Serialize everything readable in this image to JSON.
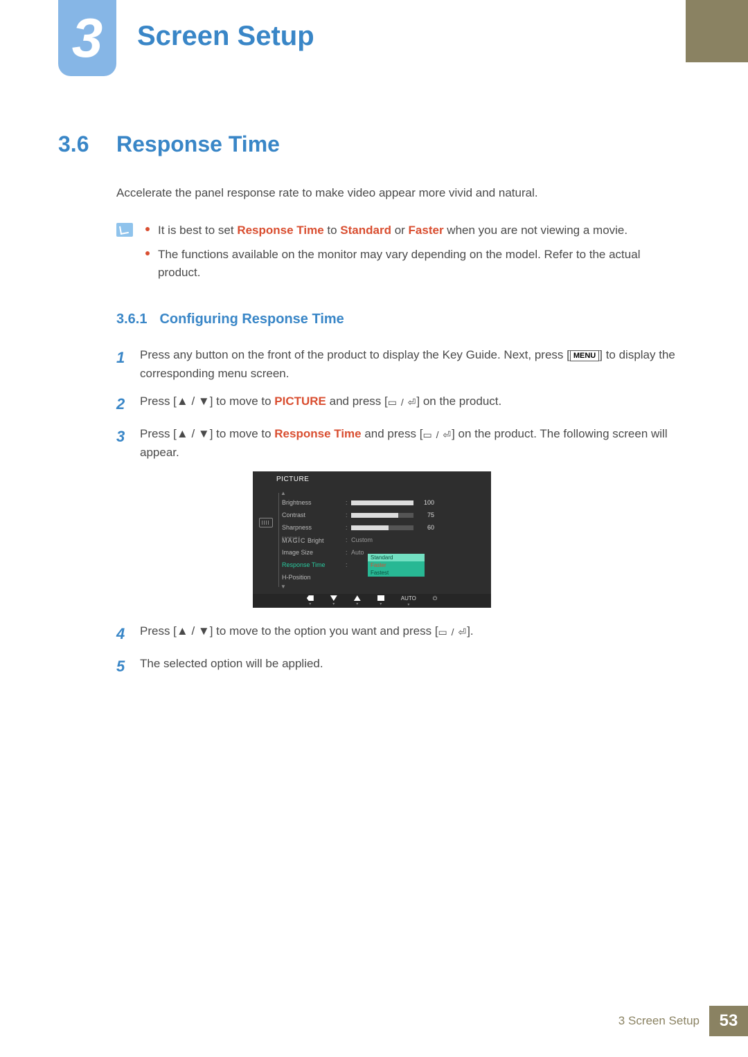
{
  "chapter": {
    "number": "3",
    "title": "Screen Setup"
  },
  "section": {
    "number": "3.6",
    "title": "Response Time"
  },
  "intro": "Accelerate the panel response rate to make video appear more vivid and natural.",
  "notes": {
    "n1_a": "It is best to set ",
    "n1_b": "Response Time",
    "n1_c": " to ",
    "n1_d": "Standard",
    "n1_e": " or ",
    "n1_f": "Faster",
    "n1_g": " when you are not viewing a movie.",
    "n2": "The functions available on the monitor may vary depending on the model. Refer to the actual product."
  },
  "subsection": {
    "number": "3.6.1",
    "title": "Configuring Response Time"
  },
  "steps": {
    "s1_a": "Press any button on the front of the product to display the Key Guide. Next, press [",
    "s1_menu": "MENU",
    "s1_b": "] to display the corresponding menu screen.",
    "s2_a": "Press [",
    "s2_b": "] to move to ",
    "s2_c": "PICTURE",
    "s2_d": " and press [",
    "s2_e": "] on the product.",
    "s3_a": "Press [",
    "s3_b": "] to move to ",
    "s3_c": "Response Time",
    "s3_d": " and press [",
    "s3_e": "] on the product. The following screen will appear.",
    "s4_a": "Press [",
    "s4_b": "] to move to the option you want and press [",
    "s4_c": "].",
    "s5": "The selected option will be applied."
  },
  "glyphs": {
    "updown": "▲ / ▼",
    "enter": "▭ / ⏎"
  },
  "osd": {
    "title": "PICTURE",
    "rows": {
      "brightness": {
        "label": "Brightness",
        "value": "100",
        "fill": 100
      },
      "contrast": {
        "label": "Contrast",
        "value": "75",
        "fill": 75
      },
      "sharpness": {
        "label": "Sharpness",
        "value": "60",
        "fill": 60
      },
      "magic": {
        "sup": "SAMSUNG",
        "main": "MAGIC",
        "suffix": " Bright",
        "value": "Custom"
      },
      "imagesize": {
        "label": "Image Size",
        "value": "Auto"
      },
      "response": {
        "label": "Response Time"
      },
      "hpos": {
        "label": "H-Position"
      }
    },
    "popup": {
      "opt1": "Standard",
      "opt2": "Faster",
      "opt3": "Fastest"
    },
    "bottom": {
      "auto": "AUTO"
    }
  },
  "footer": {
    "label": "3 Screen Setup",
    "page": "53"
  }
}
